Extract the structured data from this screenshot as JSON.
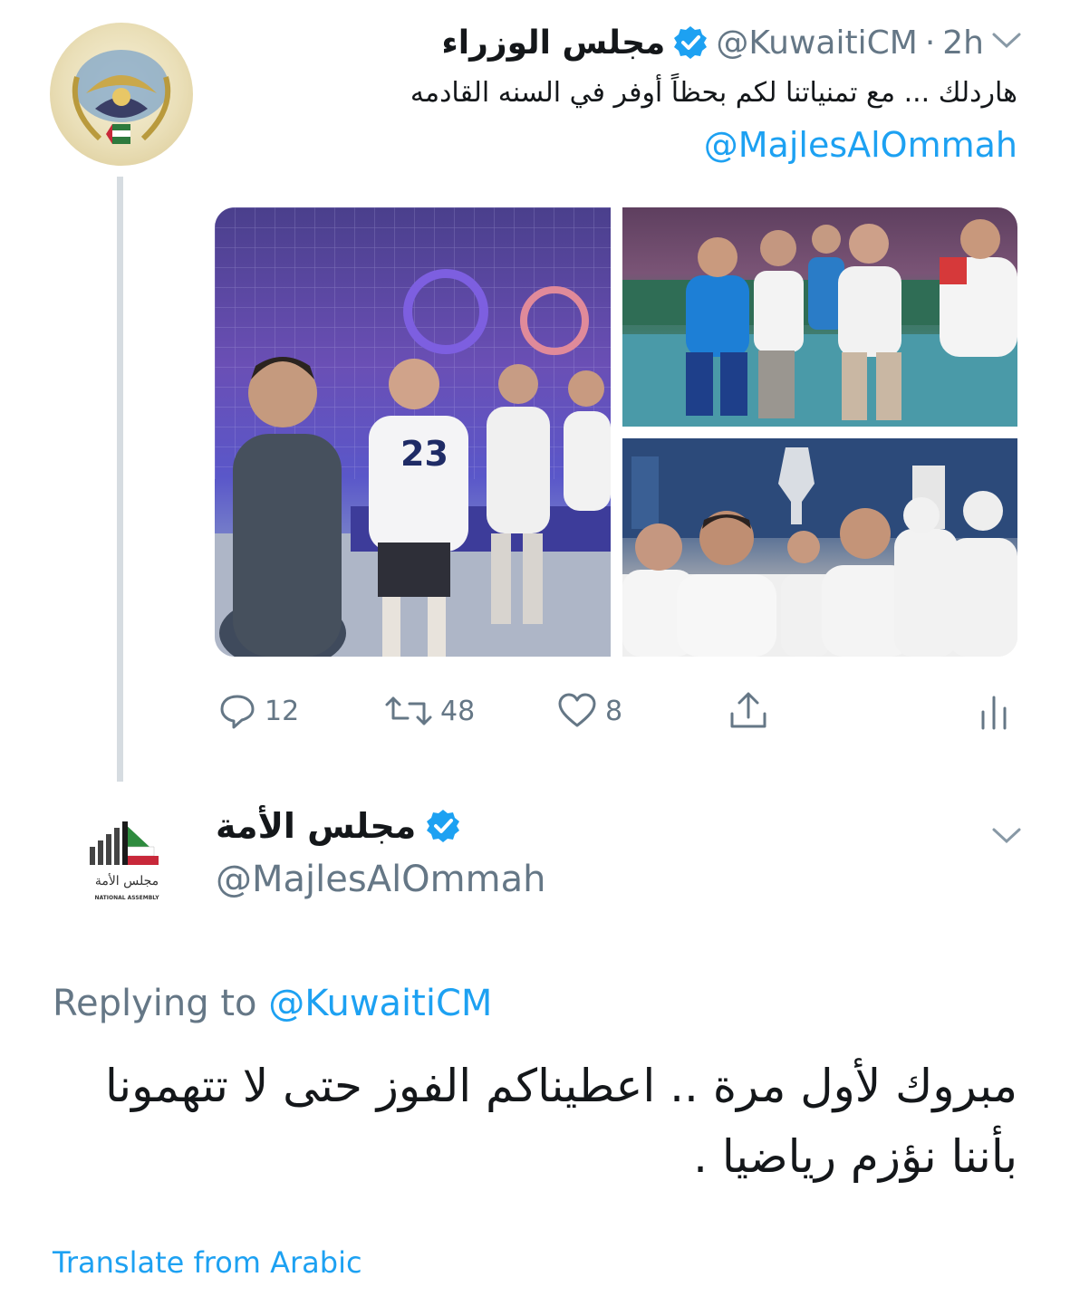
{
  "tweet1": {
    "display_name": "مجلس الوزراء",
    "handle": "@KuwaitiCM",
    "time": "2h",
    "separator": "·",
    "text": "هاردلك ... مع تمنياتنا لكم بحظاً أوفر في السنه القادمه",
    "mention": "@MajlesAlOmmah",
    "photos": {
      "left": {
        "shirt_number": "23"
      }
    },
    "actions": {
      "reply_count": "12",
      "retweet_count": "48",
      "like_count": "8"
    },
    "icons": [
      "chevron-down-icon",
      "verified-badge-icon",
      "reply-icon",
      "retweet-icon",
      "like-icon",
      "share-icon",
      "analytics-icon"
    ]
  },
  "tweet2": {
    "display_name": "مجلس الأمة",
    "handle": "@MajlesAlOmmah",
    "replying_label": "Replying to",
    "replying_handle": "@KuwaitiCM",
    "text": "مبروك لأول مرة .. اعطيناكم الفوز حتى لا تتهمونا بأننا نؤزم رياضيا .",
    "translate_label": "Translate from Arabic",
    "logo_text": "مجلس الأمة",
    "logo_caption": "NATIONAL ASSEMBLY"
  },
  "colors": {
    "brand_blue": "#1da1f2",
    "secondary_text": "#657786",
    "primary_text": "#14171a",
    "thread_line": "#d6dce1"
  }
}
